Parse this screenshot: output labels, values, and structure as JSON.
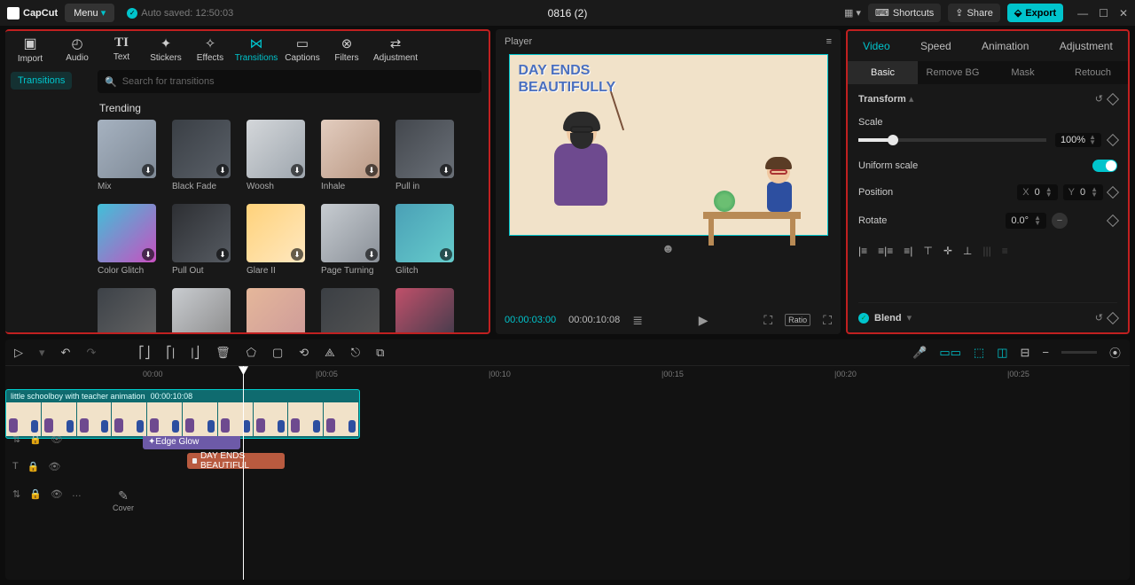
{
  "app": {
    "name": "CapCut",
    "menu": "Menu",
    "autosave": "Auto saved: 12:50:03",
    "title": "0816 (2)"
  },
  "topbar": {
    "shortcuts": "Shortcuts",
    "share": "Share",
    "export": "Export"
  },
  "library": {
    "import": "Import",
    "tabs": [
      "Audio",
      "Text",
      "Stickers",
      "Effects",
      "Transitions",
      "Captions",
      "Filters",
      "Adjustment"
    ],
    "sideActive": "Transitions",
    "searchPlaceholder": "Search for transitions",
    "section": "Trending",
    "items": [
      "Mix",
      "Black Fade",
      "Woosh",
      "Inhale",
      "Pull in",
      "Color Glitch",
      "Pull Out",
      "Glare II",
      "Page Turning",
      "Glitch",
      "",
      "",
      "",
      "",
      ""
    ]
  },
  "player": {
    "label": "Player",
    "textLine1": "DAY ENDS",
    "textLine2": "BEAUTIFULLY",
    "timeA": "00:00:03:00",
    "timeB": "00:00:10:08",
    "ratio": "Ratio"
  },
  "inspector": {
    "tabs": [
      "Video",
      "Speed",
      "Animation",
      "Adjustment"
    ],
    "subtabs": [
      "Basic",
      "Remove BG",
      "Mask",
      "Retouch"
    ],
    "transform": "Transform",
    "scale": "Scale",
    "scaleVal": "100%",
    "uniform": "Uniform scale",
    "position": "Position",
    "x": "X",
    "xv": "0",
    "y": "Y",
    "yv": "0",
    "rotate": "Rotate",
    "rv": "0.0°",
    "blend": "Blend"
  },
  "timeline": {
    "ticks": [
      "00:00",
      "|00:05",
      "|00:10",
      "|00:15",
      "|00:20",
      "|00:25"
    ],
    "effectClip": "Edge Glow",
    "textClip": "DAY ENDS BEAUTIFUL",
    "videoClipName": "little schoolboy with teacher animation",
    "videoClipDur": "00:00:10:08",
    "cover": "Cover"
  }
}
